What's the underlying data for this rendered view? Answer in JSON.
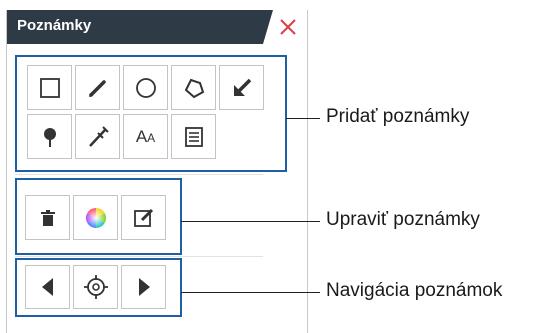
{
  "panel": {
    "title": "Poznámky",
    "header_color": "#2f3a47",
    "close_color": "#d9414a"
  },
  "groups": {
    "add": {
      "label": "Pridať poznámky",
      "tools": [
        "rectangle-icon",
        "pencil-icon",
        "circle-icon",
        "polygon-icon",
        "arrow-icon",
        "pin-icon",
        "measure-icon",
        "text-icon",
        "note-icon"
      ],
      "text_tool_label": "AA"
    },
    "edit": {
      "label": "Upraviť poznámky",
      "tools": [
        "trash-icon",
        "color-picker-icon",
        "edit-icon"
      ]
    },
    "nav": {
      "label": "Navigácia poznámok",
      "tools": [
        "previous-icon",
        "locate-icon",
        "next-icon"
      ]
    }
  },
  "accent_color": "#1f5fa6"
}
